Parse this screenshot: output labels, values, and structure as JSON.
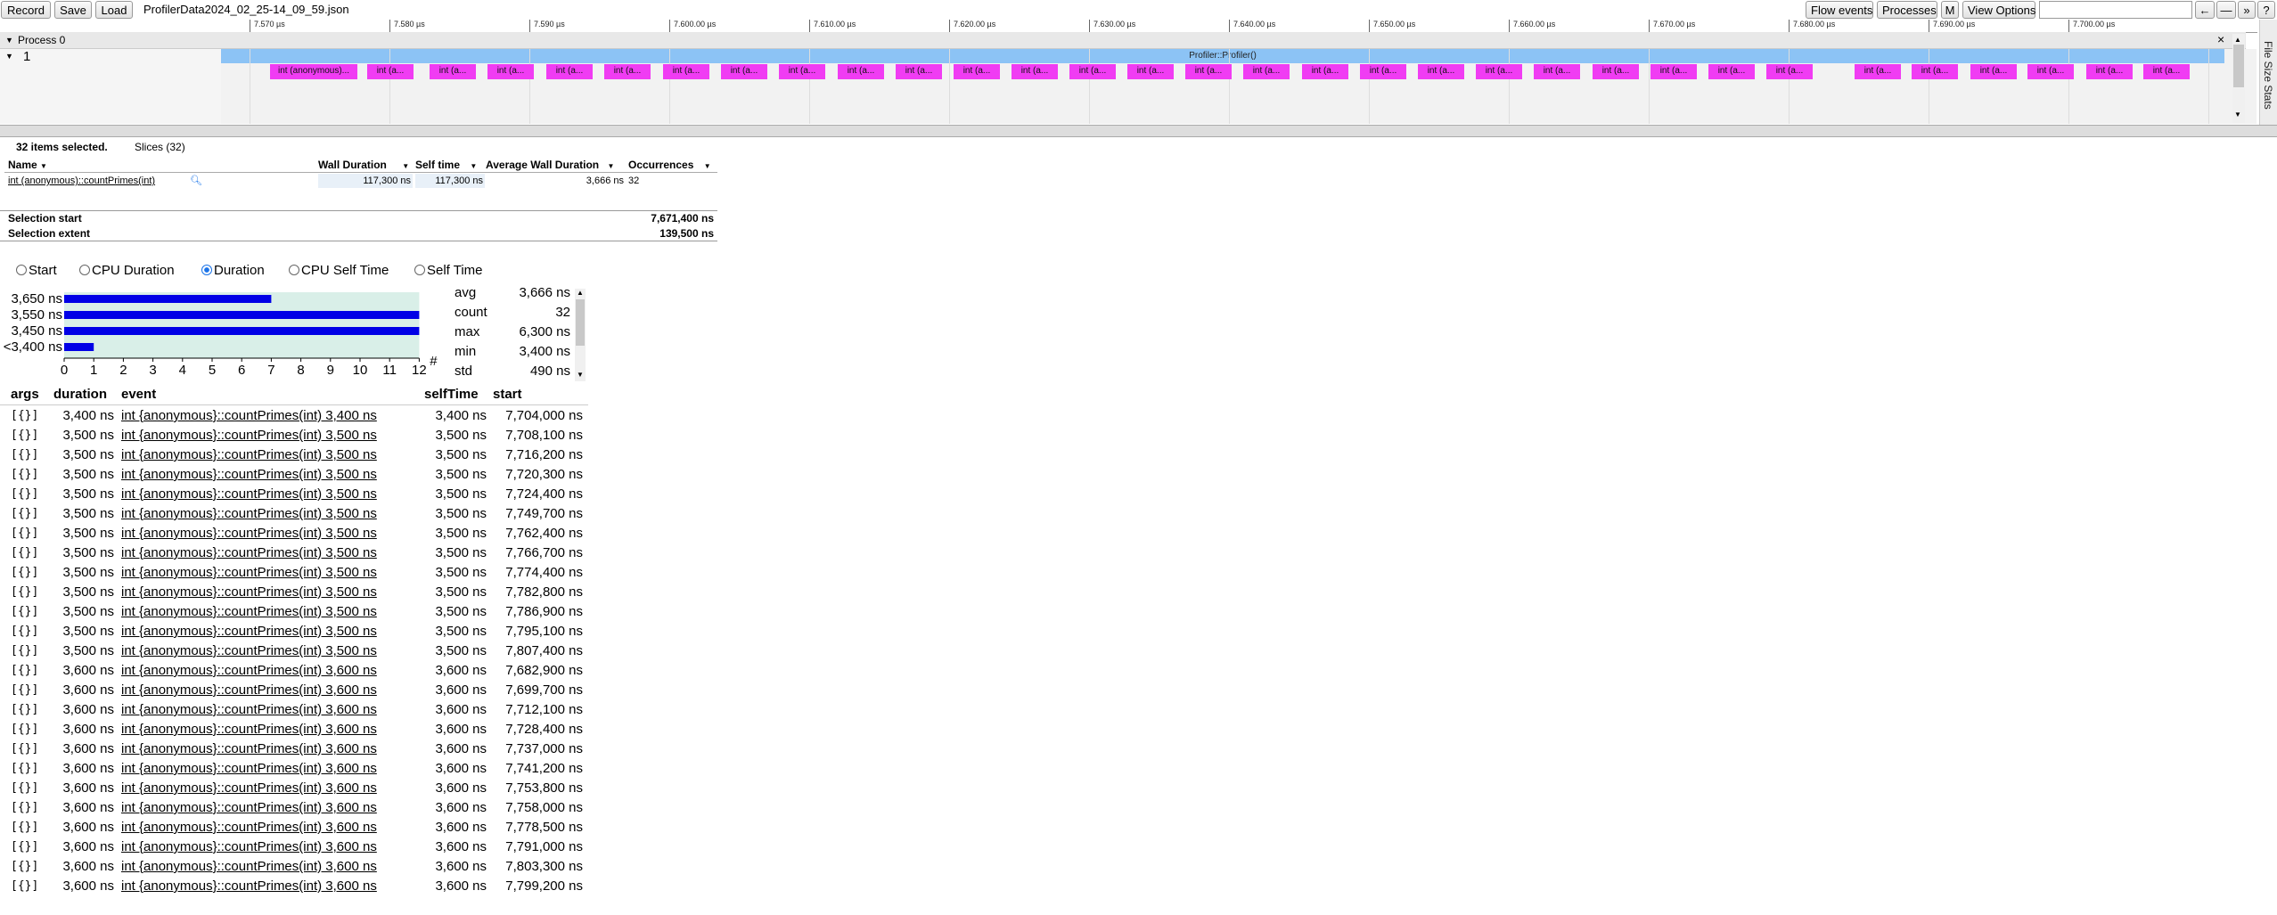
{
  "toolbar": {
    "record": "Record",
    "save": "Save",
    "load": "Load",
    "filename": "ProfilerData2024_02_25-14_09_59.json",
    "flow_events": "Flow events",
    "processes": "Processes",
    "m": "M",
    "view_options": "View Options",
    "nav_prev": "←",
    "nav_dash": "—",
    "nav_next": "»",
    "help": "?"
  },
  "ruler": {
    "ticks": [
      "7.570 µs",
      "7.580 µs",
      "7.590 µs",
      "7.600.00 µs",
      "7.610.00 µs",
      "7.620.00 µs",
      "7.630.00 µs",
      "7.640.00 µs",
      "7.650.00 µs",
      "7.660.00 µs",
      "7.670.00 µs",
      "7.680.00 µs",
      "7.690.00 µs",
      "7.700.00 µs"
    ]
  },
  "process": {
    "header": "Process 0",
    "thread": "1",
    "parent_slice": "Profiler::Profiler()",
    "close": "×",
    "side_tab": "File Size Stats",
    "slices": [
      "int (anonymous)...",
      "int (a...",
      "int (a...",
      "int (a...",
      "int (a...",
      "int (a...",
      "int (a...",
      "int (a...",
      "int (a...",
      "int (a...",
      "int (a...",
      "int (a...",
      "int (a...",
      "int (a...",
      "int (a...",
      "int (a...",
      "int (a...",
      "int (a...",
      "int (a...",
      "int (a...",
      "int (a...",
      "int (a...",
      "int (a...",
      "int (a...",
      "int (a...",
      "int (a...",
      "int (a...",
      "int (a...",
      "int (a...",
      "int (a...",
      "int (a...",
      "int (a..."
    ]
  },
  "selection": {
    "summary": "32 items selected.",
    "tab": "Slices (32)",
    "columns": [
      "Name",
      "Wall Duration",
      "Self time",
      "Average Wall Duration",
      "Occurrences"
    ],
    "sort_arrow": "▼",
    "row": {
      "name": "int (anonymous)::countPrimes(int)",
      "wall": "117,300 ns",
      "self": "117,300 ns",
      "avg": "3,666 ns",
      "occ": "32"
    },
    "start_label": "Selection start",
    "start_value": "7,671,400 ns",
    "extent_label": "Selection extent",
    "extent_value": "139,500 ns"
  },
  "radios": [
    {
      "label": "Start",
      "checked": false
    },
    {
      "label": "CPU Duration",
      "checked": false
    },
    {
      "label": "Duration",
      "checked": true
    },
    {
      "label": "CPU Self Time",
      "checked": false
    },
    {
      "label": "Self Time",
      "checked": false
    }
  ],
  "chart_data": {
    "type": "bar",
    "orientation": "horizontal",
    "categories": [
      "3,650 ns",
      "3,550 ns",
      "3,450 ns",
      "<3,400 ns"
    ],
    "values": [
      7,
      12,
      12,
      1
    ],
    "xlabel": "#",
    "xticks": [
      "0",
      "1",
      "2",
      "3",
      "4",
      "5",
      "6",
      "7",
      "8",
      "9",
      "10",
      "11",
      "12"
    ],
    "xlim": [
      0,
      12
    ],
    "colors": {
      "bar": "#0000e6",
      "background": "#d9efe8"
    }
  },
  "stats": [
    {
      "label": "avg",
      "value": "3,666 ns"
    },
    {
      "label": "count",
      "value": "32"
    },
    {
      "label": "max",
      "value": "6,300 ns"
    },
    {
      "label": "min",
      "value": "3,400 ns"
    },
    {
      "label": "std",
      "value": "490 ns"
    }
  ],
  "events": {
    "columns": [
      "args",
      "duration",
      "event",
      "selfTime",
      "start"
    ],
    "rows": [
      {
        "args": "[{}]",
        "duration": "3,400 ns",
        "event": "int {anonymous}::countPrimes(int) 3,400 ns",
        "self": "3,400 ns",
        "start": "7,704,000 ns"
      },
      {
        "args": "[{}]",
        "duration": "3,500 ns",
        "event": "int {anonymous}::countPrimes(int) 3,500 ns",
        "self": "3,500 ns",
        "start": "7,708,100 ns"
      },
      {
        "args": "[{}]",
        "duration": "3,500 ns",
        "event": "int {anonymous}::countPrimes(int) 3,500 ns",
        "self": "3,500 ns",
        "start": "7,716,200 ns"
      },
      {
        "args": "[{}]",
        "duration": "3,500 ns",
        "event": "int {anonymous}::countPrimes(int) 3,500 ns",
        "self": "3,500 ns",
        "start": "7,720,300 ns"
      },
      {
        "args": "[{}]",
        "duration": "3,500 ns",
        "event": "int {anonymous}::countPrimes(int) 3,500 ns",
        "self": "3,500 ns",
        "start": "7,724,400 ns"
      },
      {
        "args": "[{}]",
        "duration": "3,500 ns",
        "event": "int {anonymous}::countPrimes(int) 3,500 ns",
        "self": "3,500 ns",
        "start": "7,749,700 ns"
      },
      {
        "args": "[{}]",
        "duration": "3,500 ns",
        "event": "int {anonymous}::countPrimes(int) 3,500 ns",
        "self": "3,500 ns",
        "start": "7,762,400 ns"
      },
      {
        "args": "[{}]",
        "duration": "3,500 ns",
        "event": "int {anonymous}::countPrimes(int) 3,500 ns",
        "self": "3,500 ns",
        "start": "7,766,700 ns"
      },
      {
        "args": "[{}]",
        "duration": "3,500 ns",
        "event": "int {anonymous}::countPrimes(int) 3,500 ns",
        "self": "3,500 ns",
        "start": "7,774,400 ns"
      },
      {
        "args": "[{}]",
        "duration": "3,500 ns",
        "event": "int {anonymous}::countPrimes(int) 3,500 ns",
        "self": "3,500 ns",
        "start": "7,782,800 ns"
      },
      {
        "args": "[{}]",
        "duration": "3,500 ns",
        "event": "int {anonymous}::countPrimes(int) 3,500 ns",
        "self": "3,500 ns",
        "start": "7,786,900 ns"
      },
      {
        "args": "[{}]",
        "duration": "3,500 ns",
        "event": "int {anonymous}::countPrimes(int) 3,500 ns",
        "self": "3,500 ns",
        "start": "7,795,100 ns"
      },
      {
        "args": "[{}]",
        "duration": "3,500 ns",
        "event": "int {anonymous}::countPrimes(int) 3,500 ns",
        "self": "3,500 ns",
        "start": "7,807,400 ns"
      },
      {
        "args": "[{}]",
        "duration": "3,600 ns",
        "event": "int {anonymous}::countPrimes(int) 3,600 ns",
        "self": "3,600 ns",
        "start": "7,682,900 ns"
      },
      {
        "args": "[{}]",
        "duration": "3,600 ns",
        "event": "int {anonymous}::countPrimes(int) 3,600 ns",
        "self": "3,600 ns",
        "start": "7,699,700 ns"
      },
      {
        "args": "[{}]",
        "duration": "3,600 ns",
        "event": "int {anonymous}::countPrimes(int) 3,600 ns",
        "self": "3,600 ns",
        "start": "7,712,100 ns"
      },
      {
        "args": "[{}]",
        "duration": "3,600 ns",
        "event": "int {anonymous}::countPrimes(int) 3,600 ns",
        "self": "3,600 ns",
        "start": "7,728,400 ns"
      },
      {
        "args": "[{}]",
        "duration": "3,600 ns",
        "event": "int {anonymous}::countPrimes(int) 3,600 ns",
        "self": "3,600 ns",
        "start": "7,737,000 ns"
      },
      {
        "args": "[{}]",
        "duration": "3,600 ns",
        "event": "int {anonymous}::countPrimes(int) 3,600 ns",
        "self": "3,600 ns",
        "start": "7,741,200 ns"
      },
      {
        "args": "[{}]",
        "duration": "3,600 ns",
        "event": "int {anonymous}::countPrimes(int) 3,600 ns",
        "self": "3,600 ns",
        "start": "7,753,800 ns"
      },
      {
        "args": "[{}]",
        "duration": "3,600 ns",
        "event": "int {anonymous}::countPrimes(int) 3,600 ns",
        "self": "3,600 ns",
        "start": "7,758,000 ns"
      },
      {
        "args": "[{}]",
        "duration": "3,600 ns",
        "event": "int {anonymous}::countPrimes(int) 3,600 ns",
        "self": "3,600 ns",
        "start": "7,778,500 ns"
      },
      {
        "args": "[{}]",
        "duration": "3,600 ns",
        "event": "int {anonymous}::countPrimes(int) 3,600 ns",
        "self": "3,600 ns",
        "start": "7,791,000 ns"
      },
      {
        "args": "[{}]",
        "duration": "3,600 ns",
        "event": "int {anonymous}::countPrimes(int) 3,600 ns",
        "self": "3,600 ns",
        "start": "7,803,300 ns"
      },
      {
        "args": "[{}]",
        "duration": "3,600 ns",
        "event": "int {anonymous}::countPrimes(int) 3,600 ns",
        "self": "3,600 ns",
        "start": "7,799,200 ns"
      }
    ]
  }
}
